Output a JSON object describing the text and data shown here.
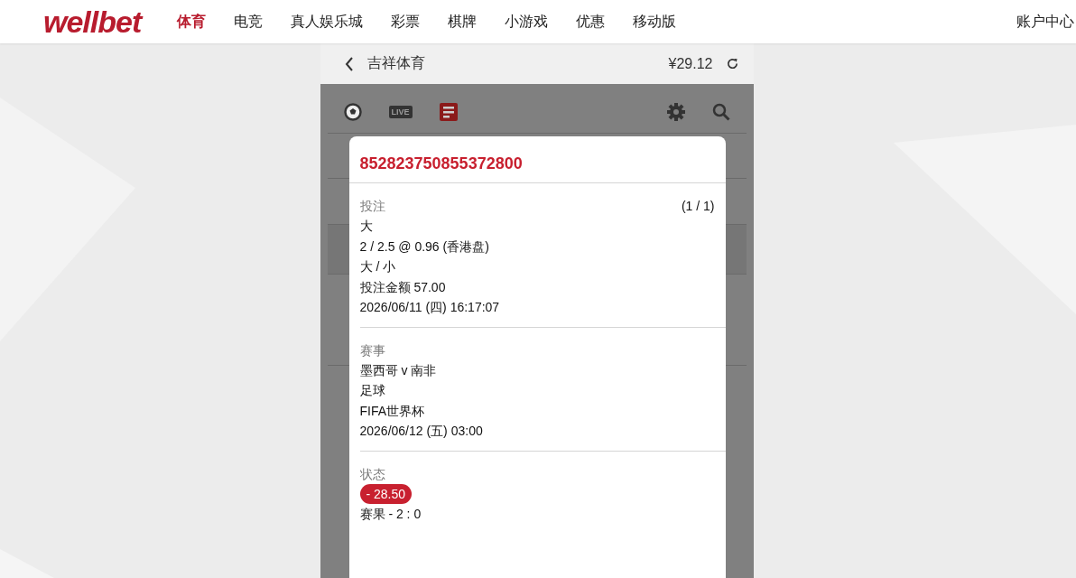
{
  "header": {
    "logo": "wellbet",
    "nav": [
      {
        "label": "体育",
        "selected": true
      },
      {
        "label": "电竞",
        "selected": false
      },
      {
        "label": "真人娱乐城",
        "selected": false
      },
      {
        "label": "彩票",
        "selected": false
      },
      {
        "label": "棋牌",
        "selected": false
      },
      {
        "label": "小游戏",
        "selected": false
      },
      {
        "label": "优惠",
        "selected": false
      },
      {
        "label": "移动版",
        "selected": false
      }
    ],
    "account": "账户中心"
  },
  "panel": {
    "title": "吉祥体育",
    "balance": "¥29.12",
    "toolbar": {
      "live_label": "LIVE"
    }
  },
  "modal": {
    "bet_id": "852823750855372800",
    "sections": [
      {
        "label": "投注",
        "counter": "(1 / 1)",
        "lines": [
          {
            "kind": "text",
            "text": "大"
          },
          {
            "kind": "text",
            "text": "2 / 2.5 @ 0.96 (香港盘)"
          },
          {
            "kind": "text",
            "text": "大 / 小"
          },
          {
            "kind": "text",
            "text": "投注金额 57.00"
          },
          {
            "kind": "text",
            "text": "2026/06/11 (四) 16:17:07"
          }
        ]
      },
      {
        "label": "赛事",
        "lines": [
          {
            "kind": "text",
            "text": "墨西哥 v 南非"
          },
          {
            "kind": "text",
            "text": "足球"
          },
          {
            "kind": "text",
            "text": "FIFA世界杯"
          },
          {
            "kind": "text",
            "text": "2026/06/12 (五) 03:00"
          }
        ]
      },
      {
        "label": "状态",
        "lines": [
          {
            "kind": "badge",
            "text": "- 28.50",
            "color": "#c8202f"
          },
          {
            "kind": "text",
            "text": "赛果 - 2 : 0"
          }
        ]
      }
    ]
  }
}
